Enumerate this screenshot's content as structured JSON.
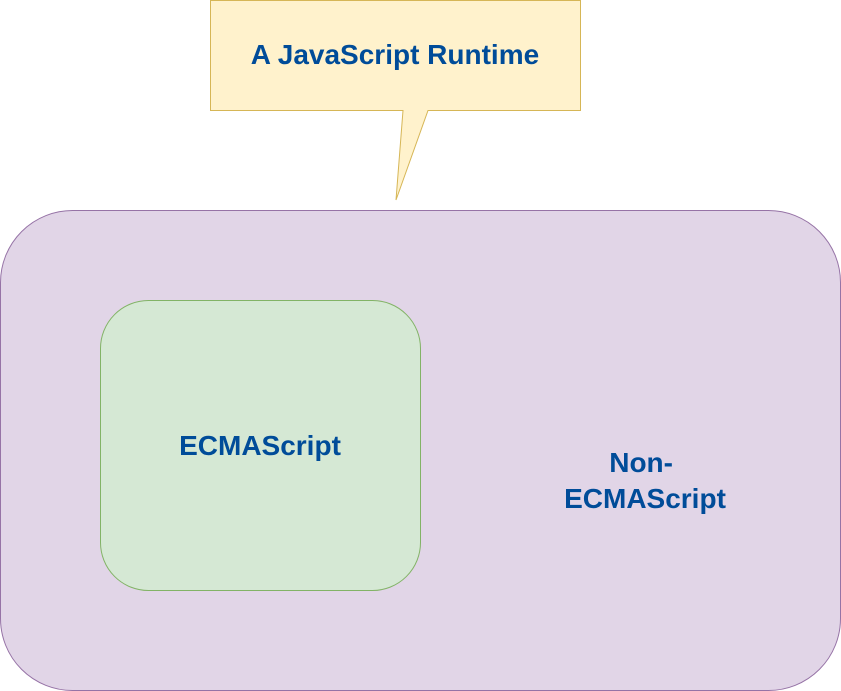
{
  "callout": {
    "text": "A JavaScript Runtime",
    "fill_color": "#fff2cc",
    "stroke_color": "#d6b656"
  },
  "runtime_container": {
    "fill_color": "#e1d5e7",
    "stroke_color": "#9673a6"
  },
  "ecmascript_box": {
    "text": "ECMAScript",
    "fill_color": "#d5e8d4",
    "stroke_color": "#82b366"
  },
  "non_ecmascript": {
    "line1": "Non-",
    "line2": "ECMAScript"
  },
  "text_color": "#004c99"
}
